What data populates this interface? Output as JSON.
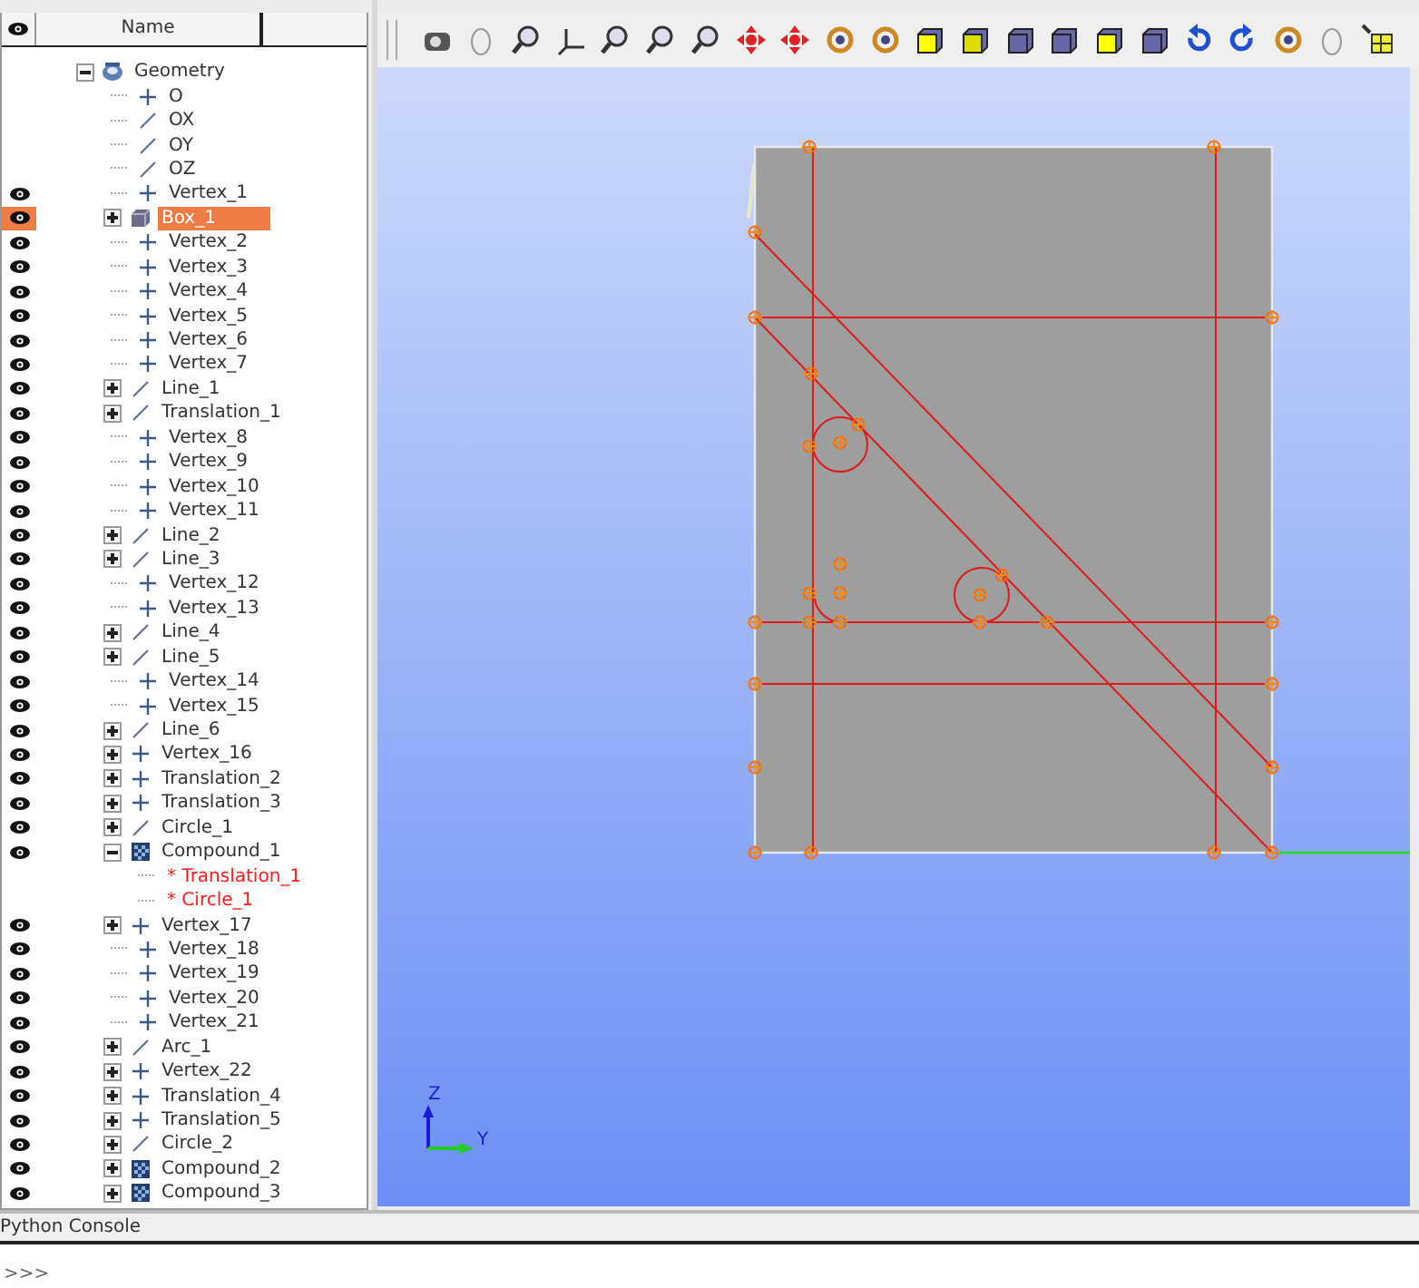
{
  "object_browser": {
    "column": "Name",
    "tree": [
      {
        "name": "Geometry",
        "kind": "geometry",
        "visible": false,
        "expandable": true,
        "expanded": true,
        "selected": false,
        "children": [
          {
            "name": "O",
            "kind": "point",
            "visible": false,
            "expandable": false,
            "selected": false
          },
          {
            "name": "OX",
            "kind": "line",
            "visible": false,
            "expandable": false,
            "selected": false
          },
          {
            "name": "OY",
            "kind": "line",
            "visible": false,
            "expandable": false,
            "selected": false
          },
          {
            "name": "OZ",
            "kind": "line",
            "visible": false,
            "expandable": false,
            "selected": false
          },
          {
            "name": "Vertex_1",
            "kind": "point",
            "visible": true,
            "expandable": false,
            "selected": false
          },
          {
            "name": "Box_1",
            "kind": "box",
            "visible": true,
            "expandable": true,
            "selected": true
          },
          {
            "name": "Vertex_2",
            "kind": "point",
            "visible": true,
            "expandable": false,
            "selected": false
          },
          {
            "name": "Vertex_3",
            "kind": "point",
            "visible": true,
            "expandable": false,
            "selected": false
          },
          {
            "name": "Vertex_4",
            "kind": "point",
            "visible": true,
            "expandable": false,
            "selected": false
          },
          {
            "name": "Vertex_5",
            "kind": "point",
            "visible": true,
            "expandable": false,
            "selected": false
          },
          {
            "name": "Vertex_6",
            "kind": "point",
            "visible": true,
            "expandable": false,
            "selected": false
          },
          {
            "name": "Vertex_7",
            "kind": "point",
            "visible": true,
            "expandable": false,
            "selected": false
          },
          {
            "name": "Line_1",
            "kind": "line",
            "visible": true,
            "expandable": true,
            "selected": false
          },
          {
            "name": "Translation_1",
            "kind": "line",
            "visible": true,
            "expandable": true,
            "selected": false
          },
          {
            "name": "Vertex_8",
            "kind": "point",
            "visible": true,
            "expandable": false,
            "selected": false
          },
          {
            "name": "Vertex_9",
            "kind": "point",
            "visible": true,
            "expandable": false,
            "selected": false
          },
          {
            "name": "Vertex_10",
            "kind": "point",
            "visible": true,
            "expandable": false,
            "selected": false
          },
          {
            "name": "Vertex_11",
            "kind": "point",
            "visible": true,
            "expandable": false,
            "selected": false
          },
          {
            "name": "Line_2",
            "kind": "line",
            "visible": true,
            "expandable": true,
            "selected": false
          },
          {
            "name": "Line_3",
            "kind": "line",
            "visible": true,
            "expandable": true,
            "selected": false
          },
          {
            "name": "Vertex_12",
            "kind": "point",
            "visible": true,
            "expandable": false,
            "selected": false
          },
          {
            "name": "Vertex_13",
            "kind": "point",
            "visible": true,
            "expandable": false,
            "selected": false
          },
          {
            "name": "Line_4",
            "kind": "line",
            "visible": true,
            "expandable": true,
            "selected": false
          },
          {
            "name": "Line_5",
            "kind": "line",
            "visible": true,
            "expandable": true,
            "selected": false
          },
          {
            "name": "Vertex_14",
            "kind": "point",
            "visible": true,
            "expandable": false,
            "selected": false
          },
          {
            "name": "Vertex_15",
            "kind": "point",
            "visible": true,
            "expandable": false,
            "selected": false
          },
          {
            "name": "Line_6",
            "kind": "line",
            "visible": true,
            "expandable": true,
            "selected": false
          },
          {
            "name": "Vertex_16",
            "kind": "point",
            "visible": true,
            "expandable": true,
            "selected": false
          },
          {
            "name": "Translation_2",
            "kind": "point",
            "visible": true,
            "expandable": true,
            "selected": false
          },
          {
            "name": "Translation_3",
            "kind": "point",
            "visible": true,
            "expandable": true,
            "selected": false
          },
          {
            "name": "Circle_1",
            "kind": "line",
            "visible": true,
            "expandable": true,
            "selected": false
          },
          {
            "name": "Compound_1",
            "kind": "compound",
            "visible": true,
            "expandable": true,
            "expanded": true,
            "selected": false,
            "children": [
              {
                "name": "* Translation_1",
                "kind": "reference",
                "visible": false,
                "expandable": false,
                "selected": false
              },
              {
                "name": "* Circle_1",
                "kind": "reference",
                "visible": false,
                "expandable": false,
                "selected": false
              }
            ]
          },
          {
            "name": "Vertex_17",
            "kind": "point",
            "visible": true,
            "expandable": true,
            "selected": false
          },
          {
            "name": "Vertex_18",
            "kind": "point",
            "visible": true,
            "expandable": false,
            "selected": false
          },
          {
            "name": "Vertex_19",
            "kind": "point",
            "visible": true,
            "expandable": false,
            "selected": false
          },
          {
            "name": "Vertex_20",
            "kind": "point",
            "visible": true,
            "expandable": false,
            "selected": false
          },
          {
            "name": "Vertex_21",
            "kind": "point",
            "visible": true,
            "expandable": false,
            "selected": false
          },
          {
            "name": "Arc_1",
            "kind": "line",
            "visible": true,
            "expandable": true,
            "selected": false
          },
          {
            "name": "Vertex_22",
            "kind": "point",
            "visible": true,
            "expandable": true,
            "selected": false
          },
          {
            "name": "Translation_4",
            "kind": "point",
            "visible": true,
            "expandable": true,
            "selected": false
          },
          {
            "name": "Translation_5",
            "kind": "point",
            "visible": true,
            "expandable": true,
            "selected": false
          },
          {
            "name": "Circle_2",
            "kind": "line",
            "visible": true,
            "expandable": true,
            "selected": false
          },
          {
            "name": "Compound_2",
            "kind": "compound",
            "visible": true,
            "expandable": true,
            "selected": false
          },
          {
            "name": "Compound_3",
            "kind": "compound",
            "visible": true,
            "expandable": true,
            "selected": false
          }
        ]
      }
    ]
  },
  "viewer": {
    "axis_labels": [
      "Z",
      "Y"
    ]
  },
  "console": {
    "title": "Python Console",
    "prompt": ">>>"
  }
}
